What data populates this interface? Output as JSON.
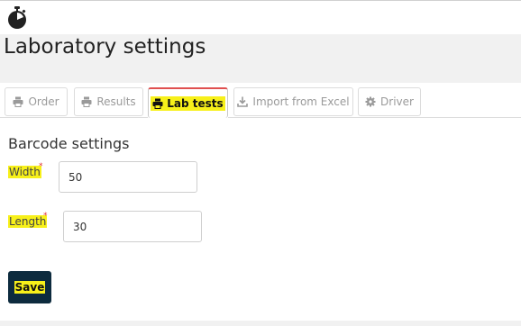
{
  "app": {
    "logo_icon": "stopwatch-icon"
  },
  "page": {
    "title": "Laboratory settings"
  },
  "tabs": [
    {
      "label": "Order",
      "icon": "printer-icon",
      "active": false
    },
    {
      "label": "Results",
      "icon": "printer-icon",
      "active": false
    },
    {
      "label": "Lab tests",
      "icon": "printer-icon",
      "active": true
    },
    {
      "label": "Import from Excel",
      "icon": "download-icon",
      "active": false
    },
    {
      "label": "Driver",
      "icon": "gear-icon",
      "active": false
    }
  ],
  "barcode": {
    "section_title": "Barcode settings",
    "width_label": "Width",
    "width_value": "50",
    "length_label": "Length",
    "length_value": "30",
    "required_marker": "*"
  },
  "actions": {
    "save_label": "Save"
  },
  "colors": {
    "highlight": "#f7f01a",
    "save_bg": "#0d2b3e",
    "active_tab_border": "#e05050"
  }
}
